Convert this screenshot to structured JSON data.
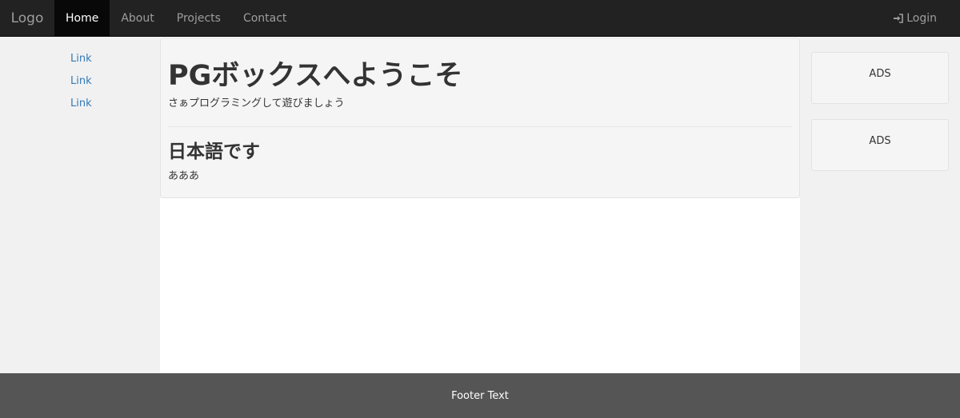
{
  "navbar": {
    "brand": "Logo",
    "items": [
      {
        "label": "Home",
        "active": true
      },
      {
        "label": "About",
        "active": false
      },
      {
        "label": "Projects",
        "active": false
      },
      {
        "label": "Contact",
        "active": false
      }
    ],
    "login_label": "Login",
    "login_icon": "log-in-icon"
  },
  "sidebar": {
    "links": [
      "Link",
      "Link",
      "Link"
    ]
  },
  "main": {
    "hero_title_bold": "PG",
    "hero_title_rest": "ボックスへようこそ",
    "hero_subtitle": "さぁプログラミングして遊びましょう",
    "section_title": "日本語です",
    "section_text": "あああ"
  },
  "ads": [
    "ADS",
    "ADS"
  ],
  "footer": {
    "text": "Footer Text"
  },
  "colors": {
    "navbar_bg": "#222222",
    "navbar_active_bg": "#080808",
    "link": "#337ab7",
    "side_bg": "#f1f1f1",
    "well_bg": "#f5f5f5",
    "footer_bg": "#555555"
  }
}
